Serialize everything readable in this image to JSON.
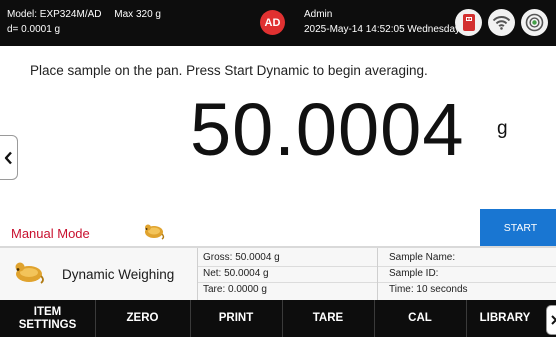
{
  "status_bar": {
    "model": "Model: EXP324M/AD",
    "max": "Max 320 g",
    "readability": "d= 0.0001 g",
    "avatar_initials": "AD",
    "user": "Admin",
    "datetime": "2025-May-14 14:52:05 Wednesday",
    "icons": [
      "usb-icon",
      "wifi-icon",
      "level-icon"
    ]
  },
  "main": {
    "instruction": "Place sample on the pan.  Press Start Dynamic to begin averaging.",
    "weight": "50.0004",
    "unit": "g",
    "mode": "Manual Mode",
    "start_label": "START"
  },
  "info_panel": {
    "app_name": "Dynamic Weighing",
    "gross": "Gross: 50.0004 g",
    "net": "Net: 50.0004 g",
    "tare": "Tare: 0.0000 g",
    "sample_name": "Sample Name:",
    "sample_id": "Sample ID:",
    "time": "Time: 10 seconds"
  },
  "softkeys": {
    "item_settings_1": "ITEM",
    "item_settings_2": "SETTINGS",
    "zero": "ZERO",
    "print": "PRINT",
    "tare": "TARE",
    "cal": "CAL",
    "library": "LIBRARY"
  },
  "colors": {
    "status_bar": "#0d0d0d",
    "avatar": "#e03131",
    "mode_text": "#c8102e",
    "start_button": "#1976d2",
    "usb_icon": "#d32f2f"
  }
}
